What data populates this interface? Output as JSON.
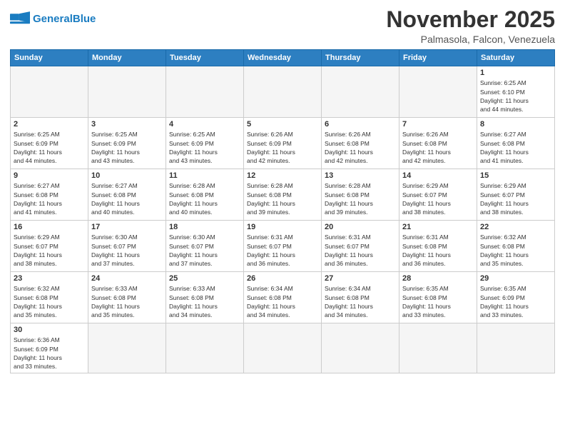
{
  "header": {
    "logo_general": "General",
    "logo_blue": "Blue",
    "month": "November 2025",
    "location": "Palmasola, Falcon, Venezuela"
  },
  "weekdays": [
    "Sunday",
    "Monday",
    "Tuesday",
    "Wednesday",
    "Thursday",
    "Friday",
    "Saturday"
  ],
  "weeks": [
    [
      {
        "day": "",
        "info": ""
      },
      {
        "day": "",
        "info": ""
      },
      {
        "day": "",
        "info": ""
      },
      {
        "day": "",
        "info": ""
      },
      {
        "day": "",
        "info": ""
      },
      {
        "day": "",
        "info": ""
      },
      {
        "day": "1",
        "info": "Sunrise: 6:25 AM\nSunset: 6:10 PM\nDaylight: 11 hours\nand 44 minutes."
      }
    ],
    [
      {
        "day": "2",
        "info": "Sunrise: 6:25 AM\nSunset: 6:09 PM\nDaylight: 11 hours\nand 44 minutes."
      },
      {
        "day": "3",
        "info": "Sunrise: 6:25 AM\nSunset: 6:09 PM\nDaylight: 11 hours\nand 43 minutes."
      },
      {
        "day": "4",
        "info": "Sunrise: 6:25 AM\nSunset: 6:09 PM\nDaylight: 11 hours\nand 43 minutes."
      },
      {
        "day": "5",
        "info": "Sunrise: 6:26 AM\nSunset: 6:09 PM\nDaylight: 11 hours\nand 42 minutes."
      },
      {
        "day": "6",
        "info": "Sunrise: 6:26 AM\nSunset: 6:08 PM\nDaylight: 11 hours\nand 42 minutes."
      },
      {
        "day": "7",
        "info": "Sunrise: 6:26 AM\nSunset: 6:08 PM\nDaylight: 11 hours\nand 42 minutes."
      },
      {
        "day": "8",
        "info": "Sunrise: 6:27 AM\nSunset: 6:08 PM\nDaylight: 11 hours\nand 41 minutes."
      }
    ],
    [
      {
        "day": "9",
        "info": "Sunrise: 6:27 AM\nSunset: 6:08 PM\nDaylight: 11 hours\nand 41 minutes."
      },
      {
        "day": "10",
        "info": "Sunrise: 6:27 AM\nSunset: 6:08 PM\nDaylight: 11 hours\nand 40 minutes."
      },
      {
        "day": "11",
        "info": "Sunrise: 6:28 AM\nSunset: 6:08 PM\nDaylight: 11 hours\nand 40 minutes."
      },
      {
        "day": "12",
        "info": "Sunrise: 6:28 AM\nSunset: 6:08 PM\nDaylight: 11 hours\nand 39 minutes."
      },
      {
        "day": "13",
        "info": "Sunrise: 6:28 AM\nSunset: 6:08 PM\nDaylight: 11 hours\nand 39 minutes."
      },
      {
        "day": "14",
        "info": "Sunrise: 6:29 AM\nSunset: 6:07 PM\nDaylight: 11 hours\nand 38 minutes."
      },
      {
        "day": "15",
        "info": "Sunrise: 6:29 AM\nSunset: 6:07 PM\nDaylight: 11 hours\nand 38 minutes."
      }
    ],
    [
      {
        "day": "16",
        "info": "Sunrise: 6:29 AM\nSunset: 6:07 PM\nDaylight: 11 hours\nand 38 minutes."
      },
      {
        "day": "17",
        "info": "Sunrise: 6:30 AM\nSunset: 6:07 PM\nDaylight: 11 hours\nand 37 minutes."
      },
      {
        "day": "18",
        "info": "Sunrise: 6:30 AM\nSunset: 6:07 PM\nDaylight: 11 hours\nand 37 minutes."
      },
      {
        "day": "19",
        "info": "Sunrise: 6:31 AM\nSunset: 6:07 PM\nDaylight: 11 hours\nand 36 minutes."
      },
      {
        "day": "20",
        "info": "Sunrise: 6:31 AM\nSunset: 6:07 PM\nDaylight: 11 hours\nand 36 minutes."
      },
      {
        "day": "21",
        "info": "Sunrise: 6:31 AM\nSunset: 6:08 PM\nDaylight: 11 hours\nand 36 minutes."
      },
      {
        "day": "22",
        "info": "Sunrise: 6:32 AM\nSunset: 6:08 PM\nDaylight: 11 hours\nand 35 minutes."
      }
    ],
    [
      {
        "day": "23",
        "info": "Sunrise: 6:32 AM\nSunset: 6:08 PM\nDaylight: 11 hours\nand 35 minutes."
      },
      {
        "day": "24",
        "info": "Sunrise: 6:33 AM\nSunset: 6:08 PM\nDaylight: 11 hours\nand 35 minutes."
      },
      {
        "day": "25",
        "info": "Sunrise: 6:33 AM\nSunset: 6:08 PM\nDaylight: 11 hours\nand 34 minutes."
      },
      {
        "day": "26",
        "info": "Sunrise: 6:34 AM\nSunset: 6:08 PM\nDaylight: 11 hours\nand 34 minutes."
      },
      {
        "day": "27",
        "info": "Sunrise: 6:34 AM\nSunset: 6:08 PM\nDaylight: 11 hours\nand 34 minutes."
      },
      {
        "day": "28",
        "info": "Sunrise: 6:35 AM\nSunset: 6:08 PM\nDaylight: 11 hours\nand 33 minutes."
      },
      {
        "day": "29",
        "info": "Sunrise: 6:35 AM\nSunset: 6:09 PM\nDaylight: 11 hours\nand 33 minutes."
      }
    ],
    [
      {
        "day": "30",
        "info": "Sunrise: 6:36 AM\nSunset: 6:09 PM\nDaylight: 11 hours\nand 33 minutes."
      },
      {
        "day": "",
        "info": ""
      },
      {
        "day": "",
        "info": ""
      },
      {
        "day": "",
        "info": ""
      },
      {
        "day": "",
        "info": ""
      },
      {
        "day": "",
        "info": ""
      },
      {
        "day": "",
        "info": ""
      }
    ]
  ]
}
